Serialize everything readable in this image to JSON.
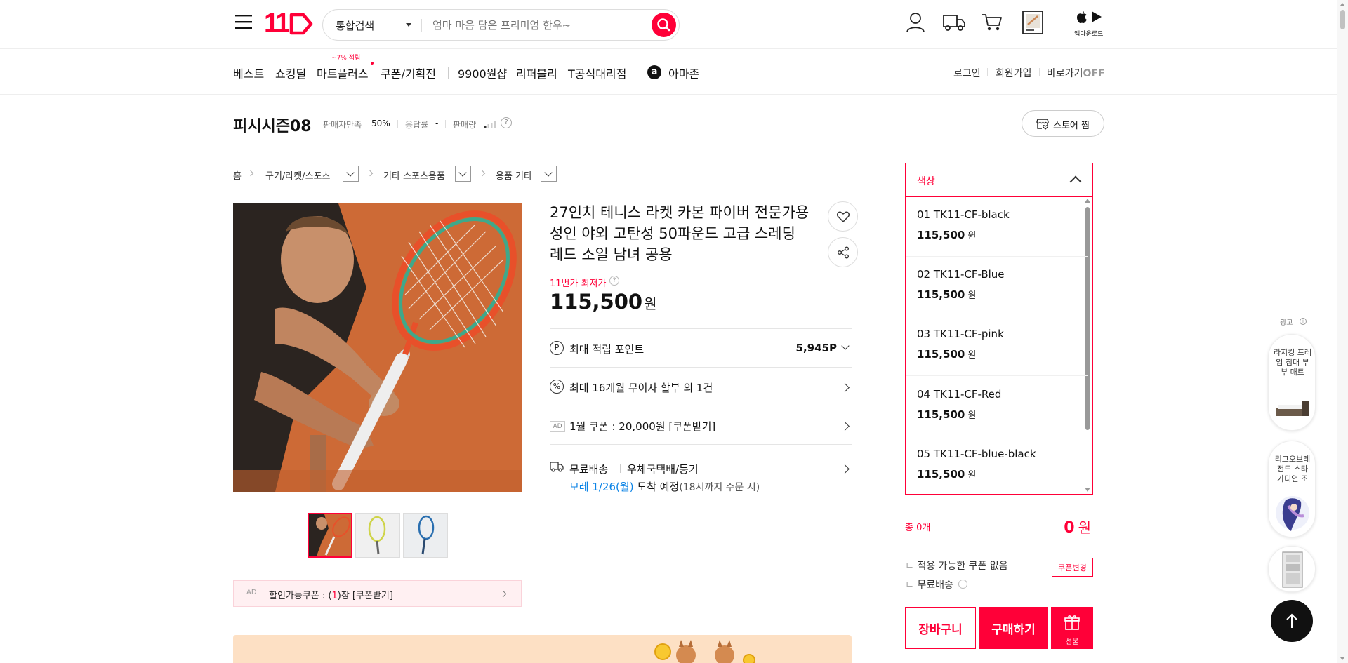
{
  "header": {
    "logo_text": "11",
    "search": {
      "category": "통합검색",
      "placeholder": "엄마 마음 담은 프리미엄 한우~"
    },
    "app_download": "앱다운로드"
  },
  "gnb": {
    "items": [
      "베스트",
      "쇼킹딜",
      "마트플러스",
      "쿠폰/기획전",
      "9900원샵",
      "리퍼블리",
      "T공식대리점",
      "아마존"
    ],
    "mart_badge": "~7% 적립",
    "amazon_logo": "a",
    "util": {
      "login": "로그인",
      "signup": "회원가입",
      "shortcut": "바로가기",
      "shortcut_state": "OFF"
    }
  },
  "seller": {
    "name": "피시시즌08",
    "satisfaction_label": "판매자만족",
    "satisfaction_value": "50%",
    "response_label": "응답률",
    "response_value": "-",
    "sales_label": "판매량",
    "store_button": "스토어 찜"
  },
  "breadcrumb": [
    "홈",
    "구기/라켓/스포츠",
    "기타 스포츠용품",
    "용품 기타"
  ],
  "product": {
    "title": "27인치 테니스 라켓 카본 파이버 전문가용 성인 야외 고탄성 50파운드 고급 스레딩 레드 소일 남녀 공용",
    "lowest_label": "11번가 최저가",
    "price": "115,500",
    "price_unit": "원",
    "points_label": "최대 적립 포인트",
    "points_value": "5,945P",
    "installment": "최대 16개월 무이자 할부 외 1건",
    "coupon_ad_label": "AD",
    "coupon": "1월 쿠폰 : 20,000원 [쿠폰받기]",
    "shipping_free": "무료배송",
    "shipping_method": "우체국택배/등기",
    "arrival_date": "모레 1/26(월)",
    "arrival_text": "도착 예정",
    "arrival_note": "(18시까지 주문 시)",
    "discount_coupon_ad": "AD",
    "discount_coupon_prefix": "할인가능쿠폰 : (",
    "discount_coupon_count": "1",
    "discount_coupon_suffix": ")장 [쿠폰받기]"
  },
  "options": {
    "header": "색상",
    "items": [
      {
        "name": "01 TK11-CF-black",
        "price": "115,500",
        "unit": "원"
      },
      {
        "name": "02 TK11-CF-Blue",
        "price": "115,500",
        "unit": "원"
      },
      {
        "name": "03 TK11-CF-pink",
        "price": "115,500",
        "unit": "원"
      },
      {
        "name": "04 TK11-CF-Red",
        "price": "115,500",
        "unit": "원"
      },
      {
        "name": "05 TK11-CF-blue-black",
        "price": "115,500",
        "unit": "원"
      }
    ]
  },
  "summary": {
    "total_label": "총 0개",
    "total_price": "0",
    "total_unit": "원",
    "coupon_none": "적용 가능한 쿠폰 없음",
    "coupon_change": "쿠폰변경",
    "free_shipping": "무료배송",
    "cart_button": "장바구니",
    "buy_button": "구매하기",
    "gift_button": "선물"
  },
  "side_ads": {
    "label": "광고",
    "items": [
      "라지킹 프레임 침대 부부 매트",
      "리그오브레전드 스타 가디언 조"
    ]
  },
  "colors": {
    "brand": "#ff0038",
    "link_blue": "#0b83e6"
  }
}
